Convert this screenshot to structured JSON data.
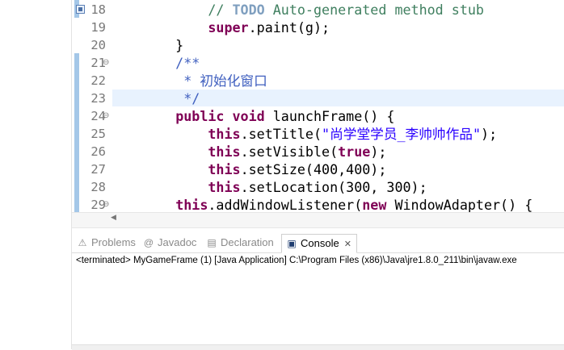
{
  "editor": {
    "lines": [
      {
        "num": "18",
        "marker": true,
        "fold": "",
        "segments": [
          {
            "t": "        ",
            "c": ""
          },
          {
            "t": "// ",
            "c": "cm"
          },
          {
            "t": "TODO",
            "c": "todo"
          },
          {
            "t": " Auto-generated method stub",
            "c": "cm"
          }
        ]
      },
      {
        "num": "19",
        "marker": false,
        "fold": "",
        "segments": [
          {
            "t": "        ",
            "c": ""
          },
          {
            "t": "super",
            "c": "kw"
          },
          {
            "t": ".paint(g);",
            "c": ""
          }
        ]
      },
      {
        "num": "20",
        "marker": false,
        "fold": "",
        "segments": [
          {
            "t": "    }",
            "c": ""
          }
        ]
      },
      {
        "num": "21",
        "marker": false,
        "fold": "⊖",
        "segments": [
          {
            "t": "    /**",
            "c": "jd"
          }
        ]
      },
      {
        "num": "22",
        "marker": false,
        "fold": "",
        "segments": [
          {
            "t": "     * 初始化窗口",
            "c": "jd"
          }
        ]
      },
      {
        "num": "23",
        "marker": false,
        "fold": "",
        "segments": [
          {
            "t": "     */",
            "c": "jd"
          }
        ]
      },
      {
        "num": "24",
        "marker": false,
        "fold": "⊖",
        "segments": [
          {
            "t": "    ",
            "c": ""
          },
          {
            "t": "public",
            "c": "kw"
          },
          {
            "t": " ",
            "c": ""
          },
          {
            "t": "void",
            "c": "kw"
          },
          {
            "t": " launchFrame() {",
            "c": ""
          }
        ]
      },
      {
        "num": "25",
        "marker": false,
        "fold": "",
        "segments": [
          {
            "t": "        ",
            "c": ""
          },
          {
            "t": "this",
            "c": "kw"
          },
          {
            "t": ".setTitle(",
            "c": ""
          },
          {
            "t": "\"尚学堂学员_李帅帅作品\"",
            "c": "st"
          },
          {
            "t": ");",
            "c": ""
          }
        ]
      },
      {
        "num": "26",
        "marker": false,
        "fold": "",
        "segments": [
          {
            "t": "        ",
            "c": ""
          },
          {
            "t": "this",
            "c": "kw"
          },
          {
            "t": ".setVisible(",
            "c": ""
          },
          {
            "t": "true",
            "c": "kw"
          },
          {
            "t": ");",
            "c": ""
          }
        ]
      },
      {
        "num": "27",
        "marker": false,
        "fold": "",
        "segments": [
          {
            "t": "        ",
            "c": ""
          },
          {
            "t": "this",
            "c": "kw"
          },
          {
            "t": ".setSize(400,400);",
            "c": ""
          }
        ]
      },
      {
        "num": "28",
        "marker": false,
        "fold": "",
        "segments": [
          {
            "t": "        ",
            "c": ""
          },
          {
            "t": "this",
            "c": "kw"
          },
          {
            "t": ".setLocation(300, 300);",
            "c": ""
          }
        ]
      },
      {
        "num": "29",
        "marker": false,
        "fold": "⊖",
        "segments": [
          {
            "t": "    ",
            "c": ""
          },
          {
            "t": "this",
            "c": "kw"
          },
          {
            "t": ".addWindowListener(",
            "c": ""
          },
          {
            "t": "new",
            "c": "kw"
          },
          {
            "t": " WindowAdapter() {",
            "c": ""
          }
        ]
      }
    ],
    "current_line": "23"
  },
  "tabs": [
    {
      "label": "Problems",
      "icon": "problems-icon",
      "glyph": "⚠",
      "active": false
    },
    {
      "label": "Javadoc",
      "icon": "javadoc-icon",
      "glyph": "@",
      "active": false
    },
    {
      "label": "Declaration",
      "icon": "declaration-icon",
      "glyph": "▤",
      "active": false
    },
    {
      "label": "Console",
      "icon": "console-icon",
      "glyph": "▣",
      "active": true
    }
  ],
  "console": {
    "status": "<terminated> MyGameFrame (1) [Java Application] C:\\Program Files (x86)\\Java\\jre1.8.0_211\\bin\\javaw.exe"
  },
  "colors": {
    "keyword": "#7f0055",
    "comment": "#3f7f5f",
    "javadoc": "#3f5fbf",
    "string": "#2a00ff",
    "todo": "#7f9fbf",
    "current_line_bg": "#e8f2fe"
  }
}
